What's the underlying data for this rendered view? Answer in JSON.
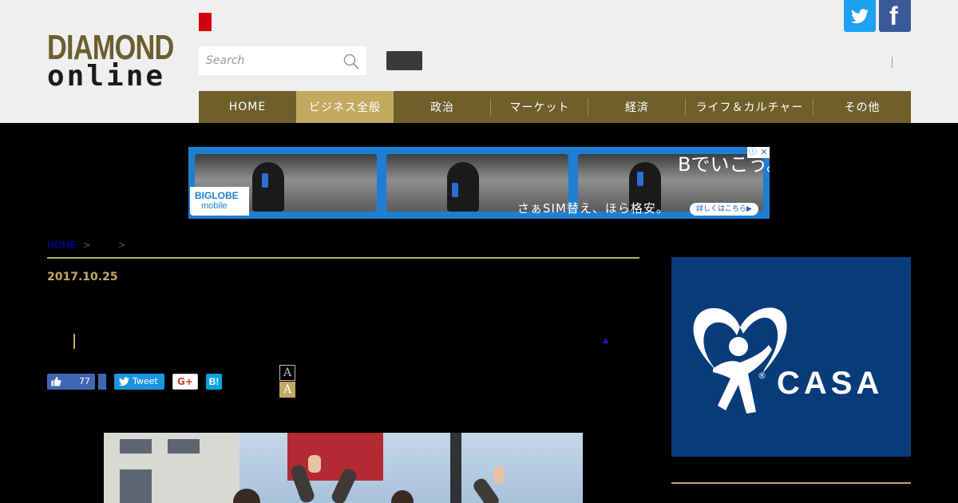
{
  "header": {
    "logo_line1": "DIAMOND",
    "logo_line2": "online",
    "search_placeholder": "Search"
  },
  "social": {
    "twitter_icon": "twitter-bird-icon",
    "facebook_icon": "facebook-f-icon",
    "facebook_glyph": "f"
  },
  "nav": {
    "items": [
      {
        "label": "HOME"
      },
      {
        "label": "ビジネス全般"
      },
      {
        "label": "政治"
      },
      {
        "label": "マーケット"
      },
      {
        "label": "経済"
      },
      {
        "label": "ライフ＆カルチャー"
      },
      {
        "label": "その他"
      }
    ],
    "active_index": 1
  },
  "ad": {
    "logo_text": "BIGLOBE",
    "logo_sub": "mobile",
    "headline": "Bでいこう。",
    "subline": "さぁSIM替え、ほら格安。",
    "cta": "詳しくはこちら▶",
    "info_icon": "ⓘ",
    "close_icon": "✕"
  },
  "article": {
    "breadcrumb_home": "HOME",
    "breadcrumb_sep": ">",
    "date": "2017.10.25",
    "triangle_glyph": "▲",
    "like_count": "77",
    "tweet_label": "Tweet",
    "gplus_label": "G+",
    "hatena_label": "B!",
    "font_small": "A",
    "font_large": "A"
  },
  "sidebar": {
    "ad_text": "CASA",
    "ad_reg": "®"
  },
  "colors": {
    "gold": "#c3a960",
    "nav_bg": "#6e5f2b",
    "twitter": "#1da1f2",
    "facebook": "#3b5998",
    "casa_blue": "#083b7a"
  }
}
